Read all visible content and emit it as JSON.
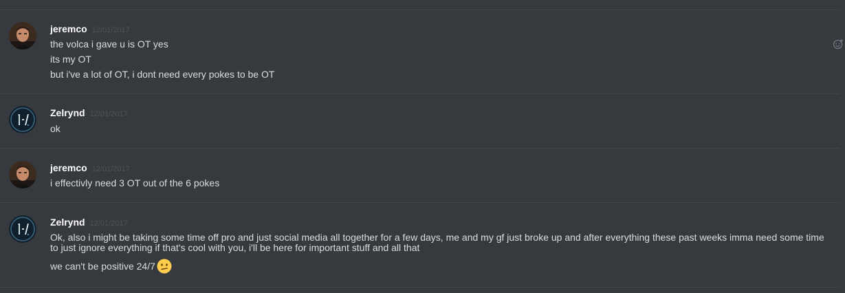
{
  "messages": [
    {
      "author": "jeremco",
      "timestamp": "12/01/2017",
      "lines": [
        "the volca i gave u is OT yes",
        "its my OT",
        "but i've a lot of OT, i dont need every pokes to be OT"
      ]
    },
    {
      "author": "Zelrynd",
      "timestamp": "12/01/2017",
      "lines": [
        "ok"
      ]
    },
    {
      "author": "jeremco",
      "timestamp": "12/01/2017",
      "lines": [
        "i effectivly need 3 OT out of the  6 pokes"
      ]
    },
    {
      "author": "Zelrynd",
      "timestamp": "12/01/2017",
      "lines": [
        "Ok, also i might be taking some time off pro and just social media all together for a few days, me and my gf just broke up and after everything these past weeks imma need some time to just ignore everything if that's cool with you, i'll be here for important stuff and all that",
        "we can't be positive 24/7"
      ],
      "emoji": "confused-face-emoji"
    }
  ],
  "icons": {
    "add_reaction": "add-reaction-icon"
  },
  "colors": {
    "background": "#36393e",
    "divider": "#42454a",
    "username": "#ffffff",
    "message_text": "#dcddde",
    "timestamp": "#4f5257",
    "emoji": "#ffcc4d"
  }
}
